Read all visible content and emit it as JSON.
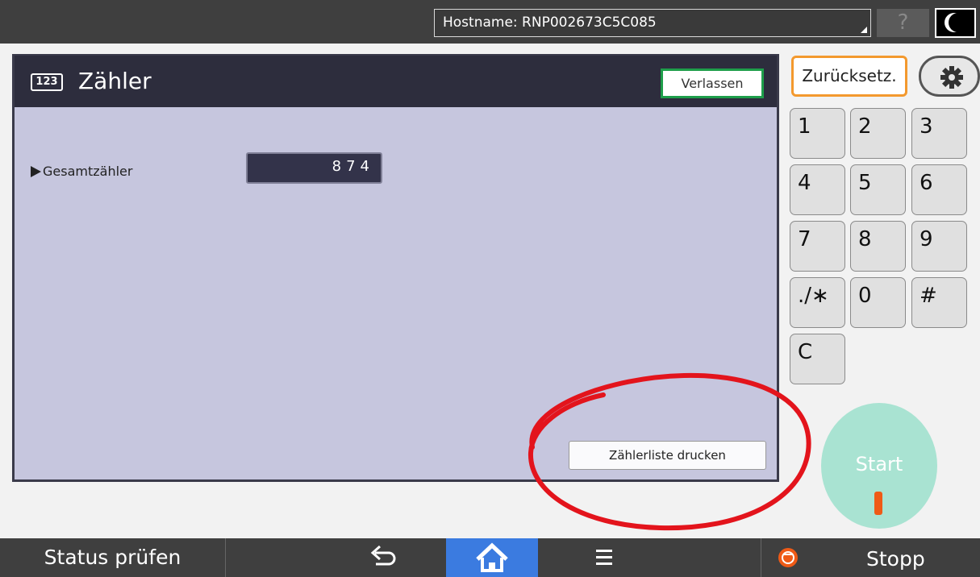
{
  "topbar": {
    "hostname": "Hostname: RNP002673C5C085",
    "help_label": "?"
  },
  "panel": {
    "icon_label": "123",
    "title": "Zähler",
    "exit_label": "Verlassen",
    "counter_label": "Gesamtzähler",
    "counter_value": "874",
    "print_label": "Zählerliste drucken"
  },
  "side": {
    "reset_label": "Zurücksetz.",
    "keys": [
      "1",
      "2",
      "3",
      "4",
      "5",
      "6",
      "7",
      "8",
      "9",
      "./∗",
      "0",
      "#",
      "C"
    ],
    "start_label": "Start"
  },
  "bottombar": {
    "status_label": "Status prüfen",
    "stop_label": "Stopp"
  },
  "colors": {
    "accent_home": "#3b7be0",
    "reset_border": "#f3992e",
    "exit_border": "#1e9e4a",
    "start": "#a9e3d2",
    "stop": "#ef5a16",
    "annotation": "#e3141c"
  }
}
